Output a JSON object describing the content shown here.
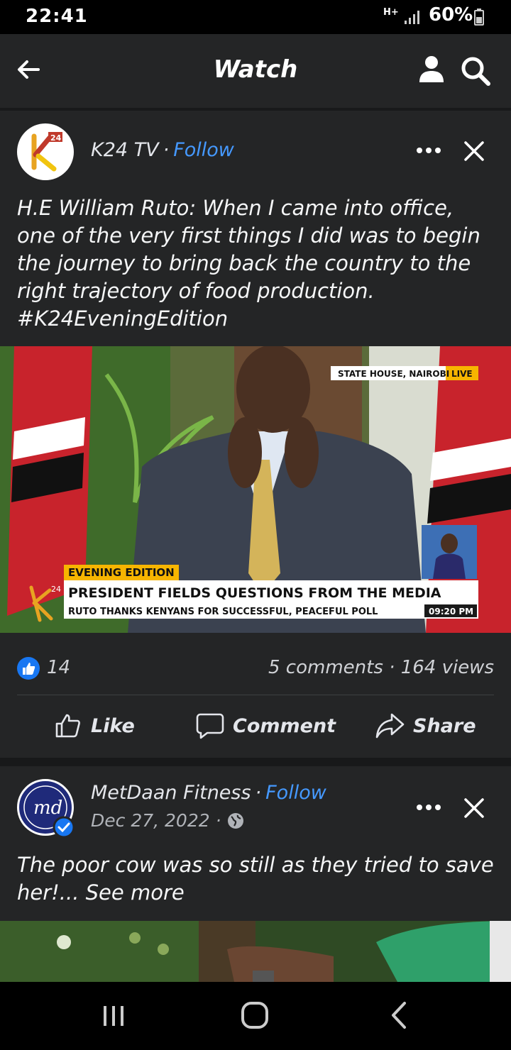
{
  "status_bar": {
    "time": "22:41",
    "network": "H+",
    "battery": "60%"
  },
  "appbar": {
    "title": "Watch"
  },
  "icons": {
    "back": "arrow-left-icon",
    "profile": "person-icon",
    "search": "magnifier-icon",
    "more": "ellipsis-icon",
    "close": "x-icon",
    "like": "thumbs-up-icon",
    "comment": "speech-bubble-icon",
    "share": "share-arrow-icon",
    "globe": "globe-icon",
    "verified": "verified-badge-icon"
  },
  "colors": {
    "accent": "#4599ff",
    "like_blue": "#1877f2",
    "background": "#242526",
    "feed_gap": "#18191a"
  },
  "post1": {
    "author": "K24 TV",
    "follow": "Follow",
    "text_lines": [
      "H.E William Ruto: When I came into office,",
      "one of the very first things I did was to begin",
      "the journey to bring back the country to the",
      "right trajectory of food production.",
      "#K24EveningEdition"
    ],
    "video": {
      "location": "STATE HOUSE, NAIROBI",
      "live": "LIVE",
      "program": "EVENING EDITION",
      "headline": "PRESIDENT FIELDS QUESTIONS FROM THE MEDIA",
      "subheadline": "RUTO THANKS KENYANS FOR SUCCESSFUL, PEACEFUL POLL",
      "time": "09:20 PM",
      "logo": "24"
    },
    "likes": "14",
    "comments": "5 comments",
    "views": "164 views",
    "actions": {
      "like": "Like",
      "comment": "Comment",
      "share": "Share"
    }
  },
  "post2": {
    "author": "MetDaan Fitness",
    "follow": "Follow",
    "date": "Dec 27, 2022",
    "avatar_text": "md",
    "text_lines": [
      "The poor cow was so still as they tried to save",
      "her!... See more"
    ]
  }
}
